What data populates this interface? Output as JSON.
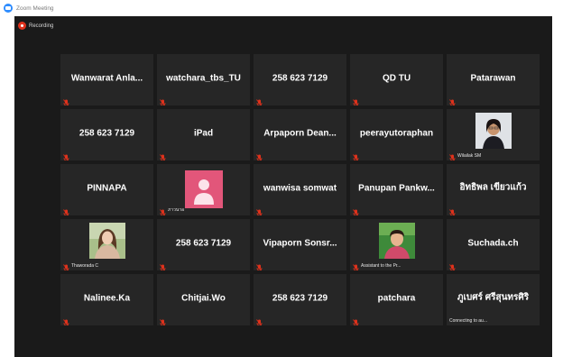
{
  "window": {
    "title": "Zoom Meeting"
  },
  "recording": {
    "label": "Recording"
  },
  "tiles": [
    {
      "name": "Wanwarat  Anla...",
      "muted": true
    },
    {
      "name": "watchara_tbs_TU",
      "muted": true
    },
    {
      "name": "258 623 7129",
      "muted": true
    },
    {
      "name": "QD TU",
      "muted": true
    },
    {
      "name": "Patarawan",
      "muted": true
    },
    {
      "name": "258 623 7129",
      "muted": true
    },
    {
      "name": "iPad",
      "muted": true
    },
    {
      "name": "Arpaporn  Dean...",
      "muted": true
    },
    {
      "name": "peerayutoraphan",
      "muted": true
    },
    {
      "name": "",
      "label": "Wilailak SM",
      "video": "photo-woman-glasses",
      "muted": true
    },
    {
      "name": "PINNAPA",
      "muted": true
    },
    {
      "name": "",
      "label": "ภาวนาอ",
      "video": "avatar-pink",
      "muted": true
    },
    {
      "name": "wanwisa somwat",
      "muted": true
    },
    {
      "name": "Panupan  Pankw...",
      "muted": true
    },
    {
      "name": "อิทธิพล  เขียวแก้ว",
      "muted": true
    },
    {
      "name": "",
      "label": "Thaworada C",
      "video": "photo-young-woman",
      "muted": true
    },
    {
      "name": "258 623 7129",
      "muted": true
    },
    {
      "name": "Vipaporn  Sonsr...",
      "muted": true
    },
    {
      "name": "",
      "label": "Assistant to the Pr...",
      "video": "photo-elder-woman",
      "muted": true
    },
    {
      "name": "Suchada.ch",
      "muted": true
    },
    {
      "name": "Nalinee.Ka",
      "muted": true
    },
    {
      "name": "Chitjai.Wo",
      "muted": true
    },
    {
      "name": "258 623 7129",
      "muted": true
    },
    {
      "name": "patchara",
      "muted": true
    },
    {
      "name": "ภูเบศร์  ศรีสุนทรศิริ",
      "label": "Connecting to au...",
      "muted": false
    }
  ],
  "colors": {
    "meeting_bg": "#1a1a1a",
    "tile_bg": "#262626",
    "mute_red": "#e0321c",
    "accent_blue": "#2d8cff",
    "avatar_pink": "#e2567a"
  }
}
